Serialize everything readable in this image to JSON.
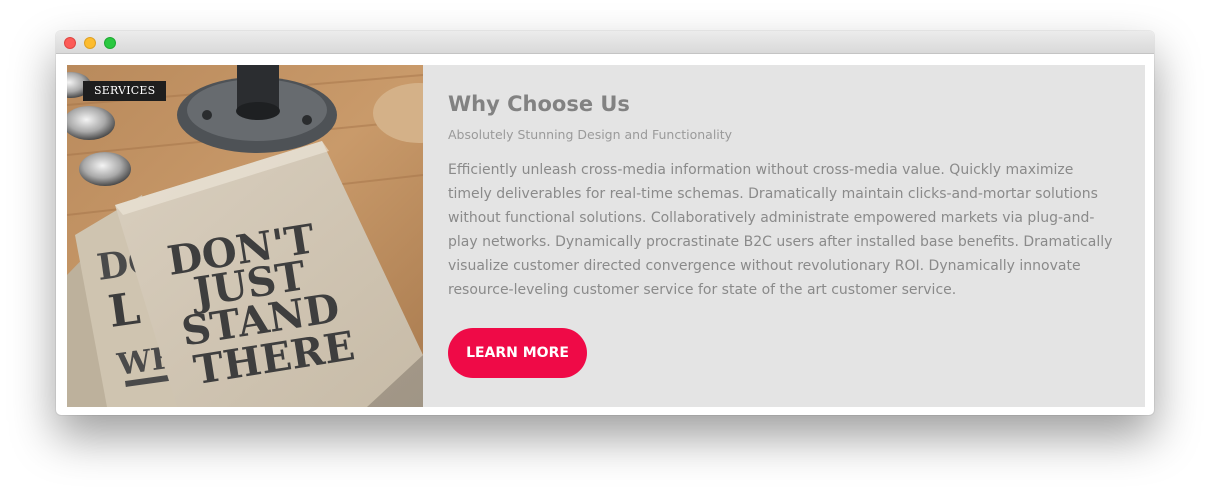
{
  "window": {
    "controls": [
      "close",
      "minimize",
      "maximize"
    ]
  },
  "card": {
    "tag": "SERVICES",
    "image": {
      "icon": "notebook-photo-icon",
      "caption_lines": [
        "DON'T",
        "JUST",
        "STAND",
        "THERE"
      ],
      "back_cover_lines": [
        "DO",
        "L",
        "WH"
      ]
    },
    "title": "Why Choose Us",
    "subtitle": "Absolutely Stunning Design and Functionality",
    "body": "Efficiently unleash cross-media information without cross-media value. Quickly maximize timely deliverables for real-time schemas. Dramatically maintain clicks-and-mortar solutions without functional solutions. Collaboratively administrate empowered markets via plug-and-play networks. Dynamically procrastinate B2C users after installed base benefits. Dramatically visualize customer directed convergence without revolutionary ROI. Dynamically innovate resource-leveling customer service for state of the art customer service.",
    "cta_label": "LEARN MORE"
  },
  "colors": {
    "accent": "#ef0a47",
    "card_bg": "#e4e4e4",
    "tag_bg": "#1e1e1e"
  }
}
